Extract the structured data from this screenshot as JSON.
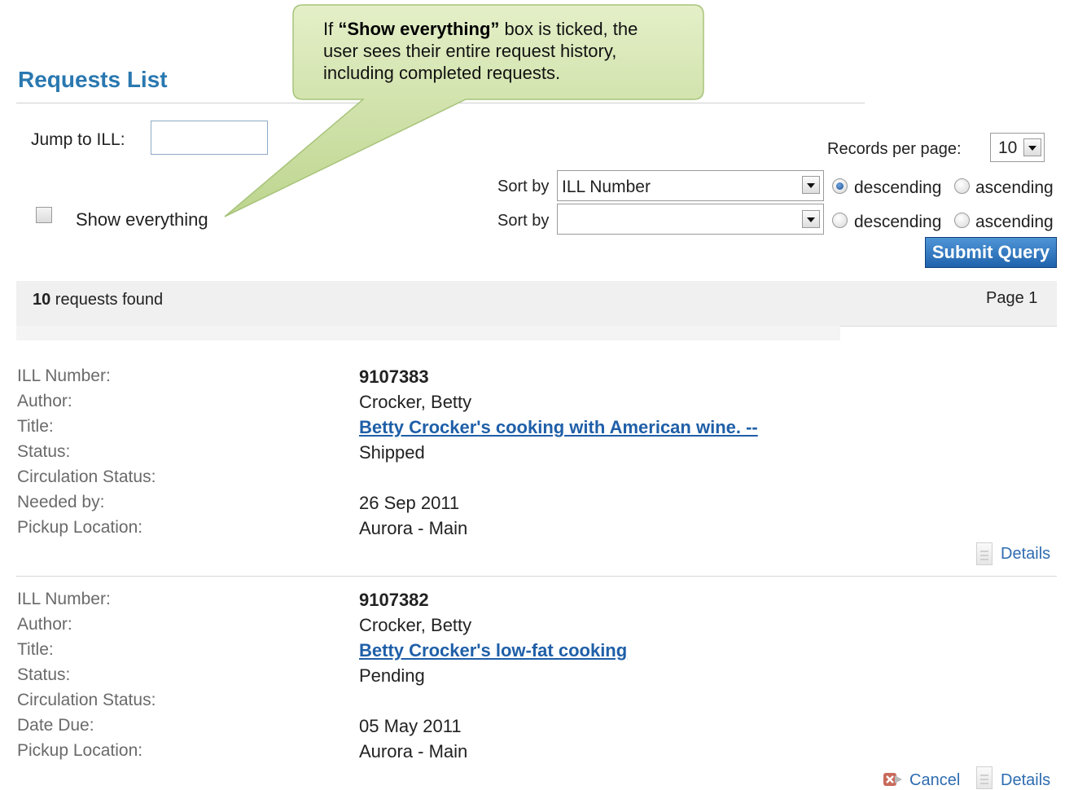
{
  "callout": {
    "prefix": "If ",
    "highlight": "“Show everything”",
    "suffix": " box is ticked, the user sees their entire request history, including completed requests."
  },
  "page_title": "Requests List",
  "jump": {
    "label": "Jump to ILL:",
    "value": ""
  },
  "show_everything": {
    "label": "Show everything",
    "checked": false
  },
  "records_per_page": {
    "label": "Records per page:",
    "value": "10"
  },
  "sort": [
    {
      "label": "Sort by",
      "value": "ILL Number",
      "desc_label": "descending",
      "asc_label": "ascending",
      "order": "descending"
    },
    {
      "label": "Sort by",
      "value": "",
      "desc_label": "descending",
      "asc_label": "ascending",
      "order": "none"
    }
  ],
  "submit_label": "Submit Query",
  "results": {
    "count": "10",
    "found_text": " requests found",
    "page_text": "Page 1"
  },
  "records": [
    {
      "rows": [
        {
          "label": "ILL Number:",
          "value": "9107383"
        },
        {
          "label": "Author:",
          "value": "Crocker, Betty"
        },
        {
          "label": "Title:",
          "value": "Betty Crocker's cooking with American wine. --"
        },
        {
          "label": "Status:",
          "value": "Shipped"
        },
        {
          "label": "Circulation Status:",
          "value": ""
        },
        {
          "label": "Needed by:",
          "value": "26 Sep 2011"
        },
        {
          "label": "Pickup Location:",
          "value": "Aurora - Main"
        }
      ],
      "details_label": "Details"
    },
    {
      "rows": [
        {
          "label": "ILL Number:",
          "value": "9107382"
        },
        {
          "label": "Author:",
          "value": "Crocker, Betty"
        },
        {
          "label": "Title:",
          "value": "Betty Crocker's low-fat cooking"
        },
        {
          "label": "Status:",
          "value": "Pending"
        },
        {
          "label": "Circulation Status:",
          "value": ""
        },
        {
          "label": "Date Due:",
          "value": "05 May 2011"
        },
        {
          "label": "Pickup Location:",
          "value": "Aurora - Main"
        }
      ],
      "cancel_label": "Cancel",
      "details_label": "Details"
    }
  ],
  "icons": [
    "checkbox",
    "dropdown-arrow-icon",
    "radio",
    "document-icon",
    "cancel-icon"
  ],
  "colors": {
    "title": "#2a78b0",
    "link": "#1f5fa8",
    "button": "#1f63ad",
    "callout": "#c8dc9c"
  }
}
